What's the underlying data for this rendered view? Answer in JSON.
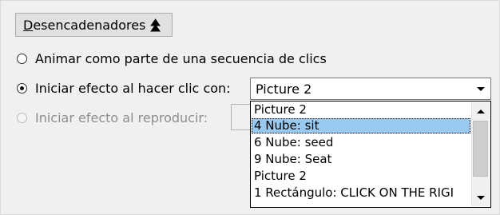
{
  "triggers_button": {
    "mnemonic": "D",
    "label_rest": "esencadenadores"
  },
  "options": [
    {
      "label": "Animar como parte de una secuencia de clics",
      "checked": false,
      "enabled": true
    },
    {
      "label": "Iniciar efecto al hacer clic con:",
      "checked": true,
      "enabled": true
    },
    {
      "label": "Iniciar efecto al reproducir:",
      "checked": false,
      "enabled": false
    }
  ],
  "combo": {
    "value": "Picture 2"
  },
  "dropdown": {
    "items": [
      "Picture 2",
      "4 Nube: sit",
      "6 Nube: seed",
      "9 Nube: Seat",
      "Picture 2",
      "1 Rectángulo: CLICK ON THE RIGI"
    ],
    "selected_index": 1
  },
  "icons": {
    "triggers_toggle": "double-chevron-up-icon",
    "combo_arrow": "chevron-down-icon",
    "scroll_up": "scroll-up-arrow-icon",
    "scroll_down": "scroll-down-arrow-icon"
  },
  "colors": {
    "selection": "#99c9ef",
    "background": "#f0f0f0"
  }
}
